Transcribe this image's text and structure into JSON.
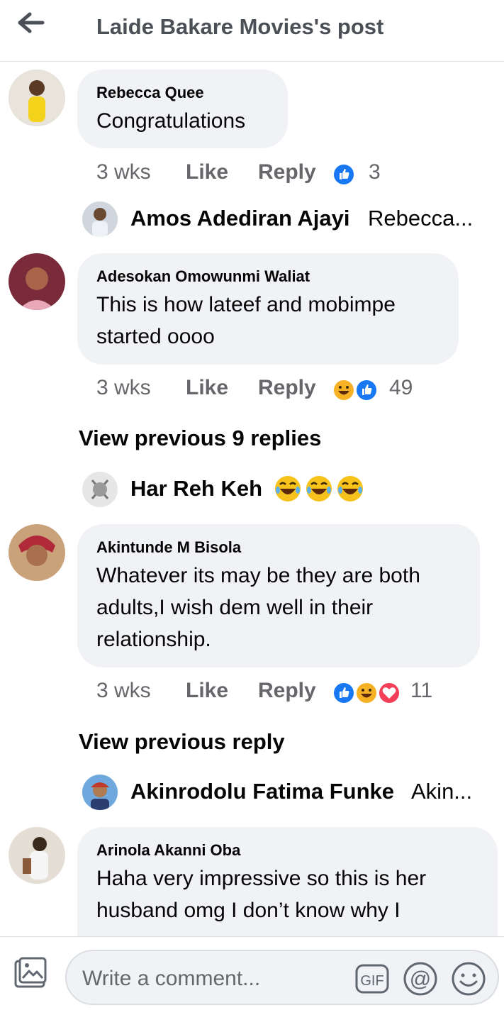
{
  "header": {
    "title": "Laide Bakare Movies's post"
  },
  "comments": [
    {
      "author": "Rebecca Quee",
      "lines": [
        "Congratulations"
      ],
      "time": "3 wks",
      "like": "Like",
      "reply": "Reply",
      "reaction_count": "3"
    },
    {
      "author": "Adesokan Omowunmi Waliat",
      "lines": [
        "This is how lateef and mobimpe",
        "started oooo"
      ],
      "time": "3 wks",
      "like": "Like",
      "reply": "Reply",
      "reaction_count": "49"
    },
    {
      "author": "Akintunde M Bisola",
      "lines": [
        "Whatever its may be they are both",
        "adults,I wish dem well in their",
        "relationship."
      ],
      "time": "3 wks",
      "like": "Like",
      "reply": "Reply",
      "reaction_count": "11"
    },
    {
      "author": "Arinola Akanni Oba",
      "lines": [
        "Haha very impressive so this is her",
        "husband omg I don’t know why I"
      ]
    }
  ],
  "replies": [
    {
      "author": "Amos Adediran Ajayi",
      "preview": "Rebecca..."
    },
    {
      "author": "Har Reh Keh",
      "preview": ""
    },
    {
      "author": "Akinrodolu Fatima Funke",
      "preview": "Akin..."
    }
  ],
  "view_previous": [
    "View previous 9 replies",
    "View previous reply"
  ],
  "footer": {
    "placeholder": "Write a comment...",
    "gif_label": "GIF"
  },
  "colors": {
    "accent": "#1877f2",
    "bubble": "#f0f2f5",
    "muted": "#65676b"
  }
}
